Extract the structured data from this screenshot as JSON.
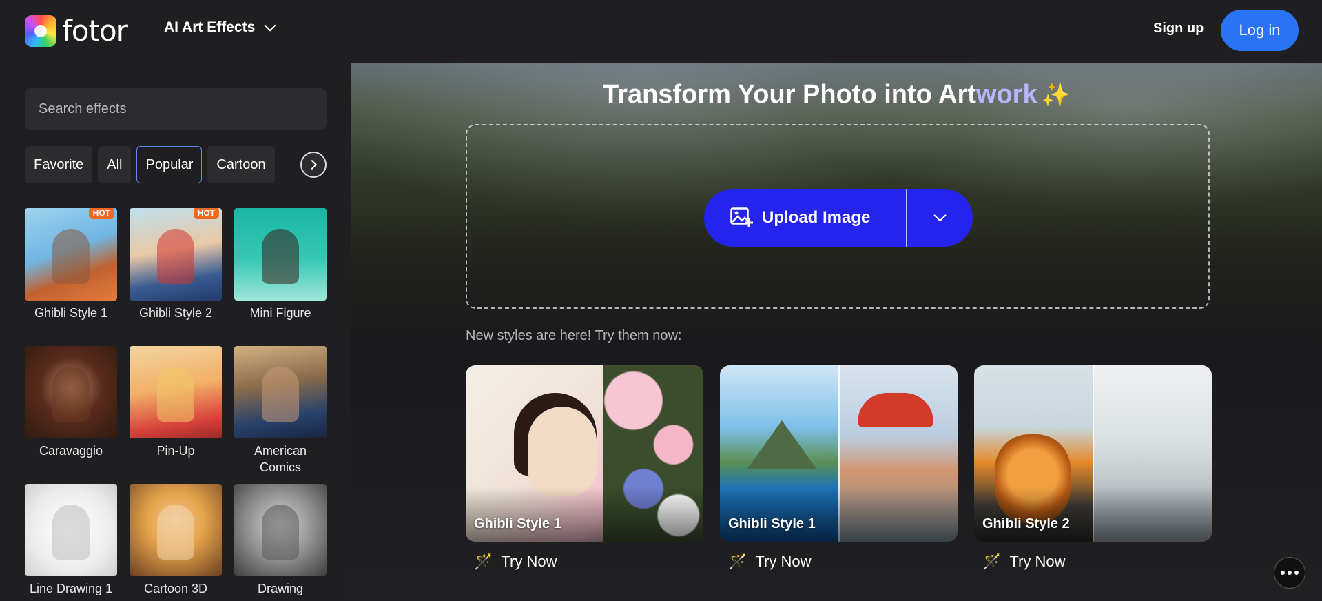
{
  "header": {
    "logo_text": "fotor",
    "nav_menu_label": "AI Art Effects",
    "signup_label": "Sign up",
    "login_label": "Log in"
  },
  "sidebar": {
    "search_placeholder": "Search effects",
    "tabs": [
      {
        "label": "Favorite",
        "active": false
      },
      {
        "label": "All",
        "active": false
      },
      {
        "label": "Popular",
        "active": true
      },
      {
        "label": "Cartoon",
        "active": false
      }
    ],
    "effects": [
      {
        "label": "Ghibli Style 1",
        "badge": "HOT"
      },
      {
        "label": "Ghibli Style 2",
        "badge": "HOT"
      },
      {
        "label": "Mini Figure",
        "badge": ""
      },
      {
        "label": "Caravaggio",
        "badge": ""
      },
      {
        "label": "Pin-Up",
        "badge": ""
      },
      {
        "label": "American Comics",
        "badge": ""
      },
      {
        "label": "Line Drawing 1",
        "badge": ""
      },
      {
        "label": "Cartoon 3D",
        "badge": ""
      },
      {
        "label": "Drawing",
        "badge": ""
      }
    ]
  },
  "main": {
    "title_prefix": "Transform Your Photo into Art",
    "title_accent": "work",
    "upload_label": "Upload Image",
    "new_styles_text": "New styles are here! Try them now:",
    "cards": [
      {
        "label": "Ghibli Style 1",
        "action": "Try Now"
      },
      {
        "label": "Ghibli Style 1",
        "action": "Try Now"
      },
      {
        "label": "Ghibli Style 2",
        "action": "Try Now"
      }
    ]
  },
  "colors": {
    "accent_blue": "#2b73f5",
    "upload_blue": "#2424ee",
    "hot_badge": "#f06a1d",
    "active_tab_border": "#5b8cff"
  },
  "icons": [
    "logo-icon",
    "chevron-down-icon",
    "chevron-right-icon",
    "image-upload-icon",
    "sparkle-icon",
    "magic-wand-icon",
    "more-icon"
  ]
}
